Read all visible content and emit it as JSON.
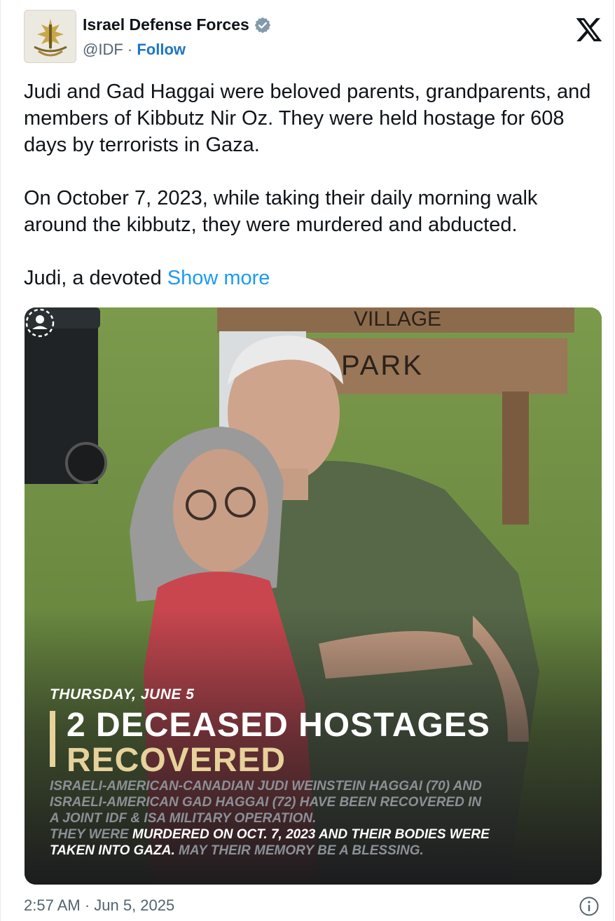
{
  "account": {
    "display_name": "Israel Defense Forces",
    "handle": "@IDF",
    "separator": "·",
    "follow_label": "Follow",
    "avatar_icon": "idf-emblem-icon",
    "verified_icon": "verified-badge-icon"
  },
  "brand_icon": "x-logo-icon",
  "tweet": {
    "paragraph1": "Judi and Gad Haggai were beloved parents, grandparents, and members of Kibbutz Nir Oz. They were held hostage for 608 days by terrorists in Gaza.",
    "paragraph2": "On October 7, 2023, while taking their daily morning walk around the kibbutz, they were murdered and abducted.",
    "paragraph3": "Judi, a devoted ",
    "show_more_label": "Show more"
  },
  "media": {
    "sign_top": "VILLAGE",
    "sign_park": "PARK",
    "date_line": "THURSDAY, JUNE 5",
    "headline_line1": "2 DECEASED HOSTAGES",
    "headline_line2": "RECOVERED",
    "caption_line1": "ISRAELI-AMERICAN-CANADIAN JUDI WEINSTEIN HAGGAI (70) AND",
    "caption_line2": "ISRAELI-AMERICAN GAD HAGGAI (72) HAVE BEEN RECOVERED IN",
    "caption_line3": "A JOINT IDF & ISA MILITARY OPERATION.",
    "caption_line4a": "THEY WERE ",
    "caption_line4b": "MURDERED ON OCT. 7, 2023 AND THEIR BODIES WERE",
    "caption_line5a": "TAKEN INTO GAZA.",
    "caption_line5b": "  MAY THEIR MEMORY BE A BLESSING.",
    "accent_color": "#e6d29a"
  },
  "footer": {
    "timestamp": "2:57 AM · Jun 5, 2025",
    "info_icon": "info-icon"
  },
  "colors": {
    "link": "#1d9bf0",
    "follow": "#1d76c6",
    "muted": "#536471"
  }
}
